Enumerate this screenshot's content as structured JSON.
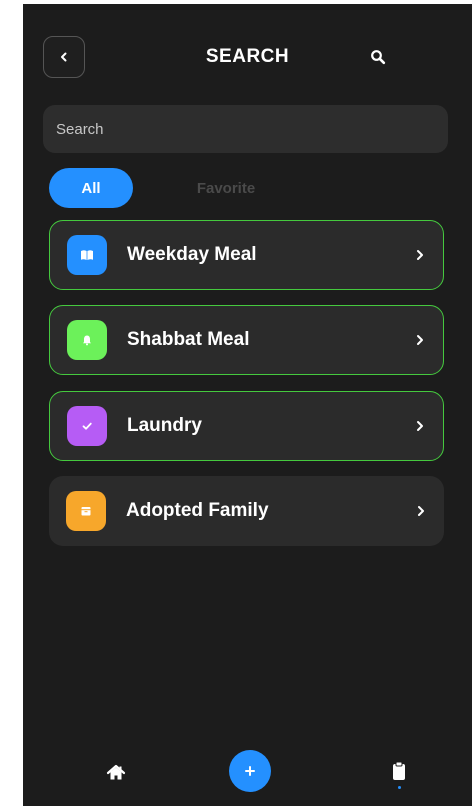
{
  "header": {
    "title": "SEARCH",
    "back_icon": "chevron-left-icon",
    "search_icon": "search-icon"
  },
  "search": {
    "placeholder": "Search",
    "value": ""
  },
  "tabs": [
    {
      "label": "All",
      "selected": true
    },
    {
      "label": "Favorite",
      "selected": false
    }
  ],
  "items": [
    {
      "label": "Weekday Meal",
      "icon": "book-icon",
      "icon_color": "#2490ff",
      "highlighted": true
    },
    {
      "label": "Shabbat Meal",
      "icon": "bell-icon",
      "icon_color": "#6cf15a",
      "highlighted": true
    },
    {
      "label": "Laundry",
      "icon": "check-icon",
      "icon_color": "#b65cf5",
      "highlighted": true
    },
    {
      "label": "Adopted Family",
      "icon": "box-icon",
      "icon_color": "#f7a72b",
      "highlighted": false
    }
  ],
  "bottom_nav": {
    "home_icon": "home-icon",
    "add_icon": "plus-icon",
    "clipboard_icon": "clipboard-icon"
  },
  "colors": {
    "background": "#1c1c1c",
    "accent": "#2490ff",
    "card": "#2b2b2b",
    "active_border": "#45c93e"
  }
}
